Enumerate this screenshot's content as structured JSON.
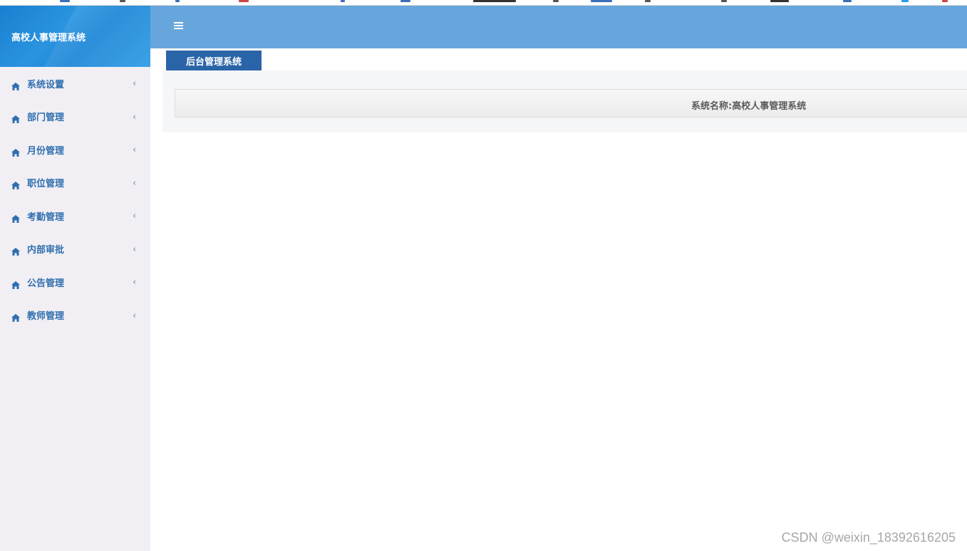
{
  "app": {
    "title": "高校人事管理系统"
  },
  "header": {
    "menu_toggle_icon": "hamburger-icon"
  },
  "sidebar": {
    "items": [
      {
        "label": "系统设置",
        "icon": "home-icon"
      },
      {
        "label": "部门管理",
        "icon": "home-icon"
      },
      {
        "label": "月份管理",
        "icon": "home-icon"
      },
      {
        "label": "职位管理",
        "icon": "home-icon"
      },
      {
        "label": "考勤管理",
        "icon": "home-icon"
      },
      {
        "label": "内部审批",
        "icon": "home-icon"
      },
      {
        "label": "公告管理",
        "icon": "home-icon"
      },
      {
        "label": "教师管理",
        "icon": "home-icon"
      }
    ],
    "expand_icon": "chevron-left-icon"
  },
  "tabs": [
    {
      "label": "后台管理系统",
      "active": true
    }
  ],
  "main": {
    "system_name": "系统名称:高校人事管理系统"
  },
  "watermark": "CSDN @weixin_18392616205",
  "colors": {
    "brand_bg": "#1a7fd0",
    "header_bg": "#67a6dc",
    "tab_active_bg": "#2a64a8",
    "sidebar_bg": "#f1eff4",
    "menu_text": "#2f6faf"
  }
}
